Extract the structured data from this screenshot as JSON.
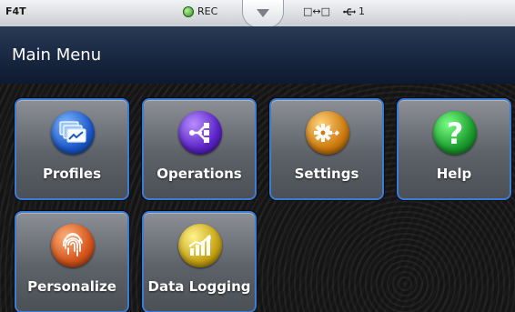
{
  "statusbar": {
    "model": "F4T",
    "rec_label": "REC",
    "network_text": "□↔□",
    "usb_count": "1"
  },
  "header": {
    "title": "Main Menu"
  },
  "tiles": [
    {
      "label": "Profiles",
      "icon": "profiles-icon",
      "color": "#1c58c8"
    },
    {
      "label": "Operations",
      "icon": "operations-icon",
      "color": "#5b23c6"
    },
    {
      "label": "Settings",
      "icon": "settings-icon",
      "color": "#cc7a0e"
    },
    {
      "label": "Help",
      "icon": "help-icon",
      "color": "#1b9b2d",
      "glyph": "?"
    },
    {
      "label": "Personalize",
      "icon": "fingerprint-icon",
      "color": "#d3541b"
    },
    {
      "label": "Data Logging",
      "icon": "data-logging-icon",
      "color": "#c7a313"
    }
  ],
  "colors": {
    "tile_border": "#3c7bd6",
    "header_bg": "#17253e",
    "status_bg": "#e5e7eb"
  }
}
